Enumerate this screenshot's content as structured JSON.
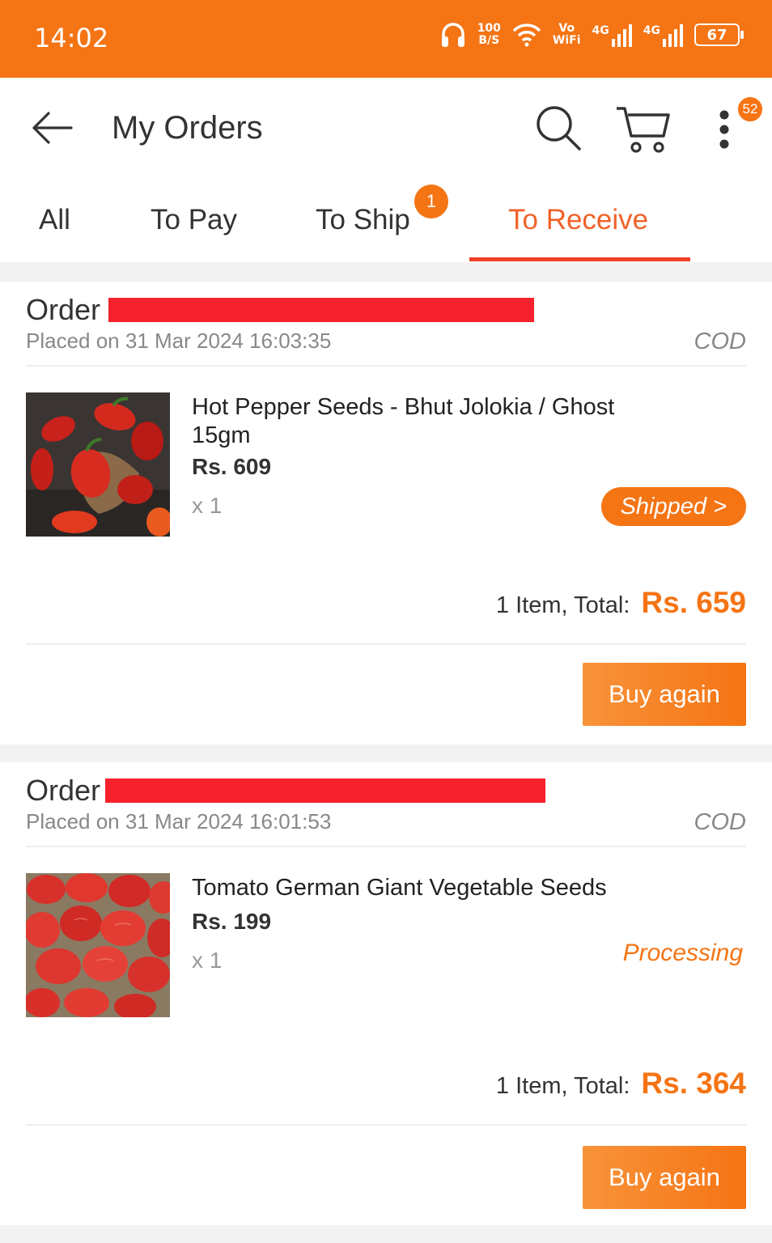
{
  "status_bar": {
    "time": "14:02",
    "speed_value": "100",
    "speed_unit": "B/S",
    "vo": "Vo",
    "wifi": "WiFi",
    "net1": "4G",
    "net2": "4G",
    "battery": "67"
  },
  "header": {
    "title": "My Orders",
    "notification_count": "52"
  },
  "tabs": [
    {
      "label": "All"
    },
    {
      "label": "To Pay"
    },
    {
      "label": "To Ship",
      "badge": "1"
    },
    {
      "label": "To Receive",
      "active": true
    }
  ],
  "orders": [
    {
      "order_label": "Order",
      "placed": "Placed on 31 Mar 2024 16:03:35",
      "payment": "COD",
      "product_name": "Hot Pepper Seeds - Bhut Jolokia / Ghost 15gm",
      "price": "Rs. 609",
      "qty": "x 1",
      "status": "Shipped >",
      "total_label": "1 Item, Total:",
      "total_amount": "Rs. 659",
      "button": "Buy again"
    },
    {
      "order_label": "Order",
      "placed": "Placed on 31 Mar 2024 16:01:53",
      "payment": "COD",
      "product_name": "Tomato German Giant Vegetable Seeds",
      "price": "Rs. 199",
      "qty": "x 1",
      "status": "Processing",
      "total_label": "1 Item, Total:",
      "total_amount": "Rs. 364",
      "button": "Buy again"
    }
  ],
  "colors": {
    "brand": "#f57414",
    "active_tab": "#f0622a",
    "redaction": "#f5222d"
  }
}
